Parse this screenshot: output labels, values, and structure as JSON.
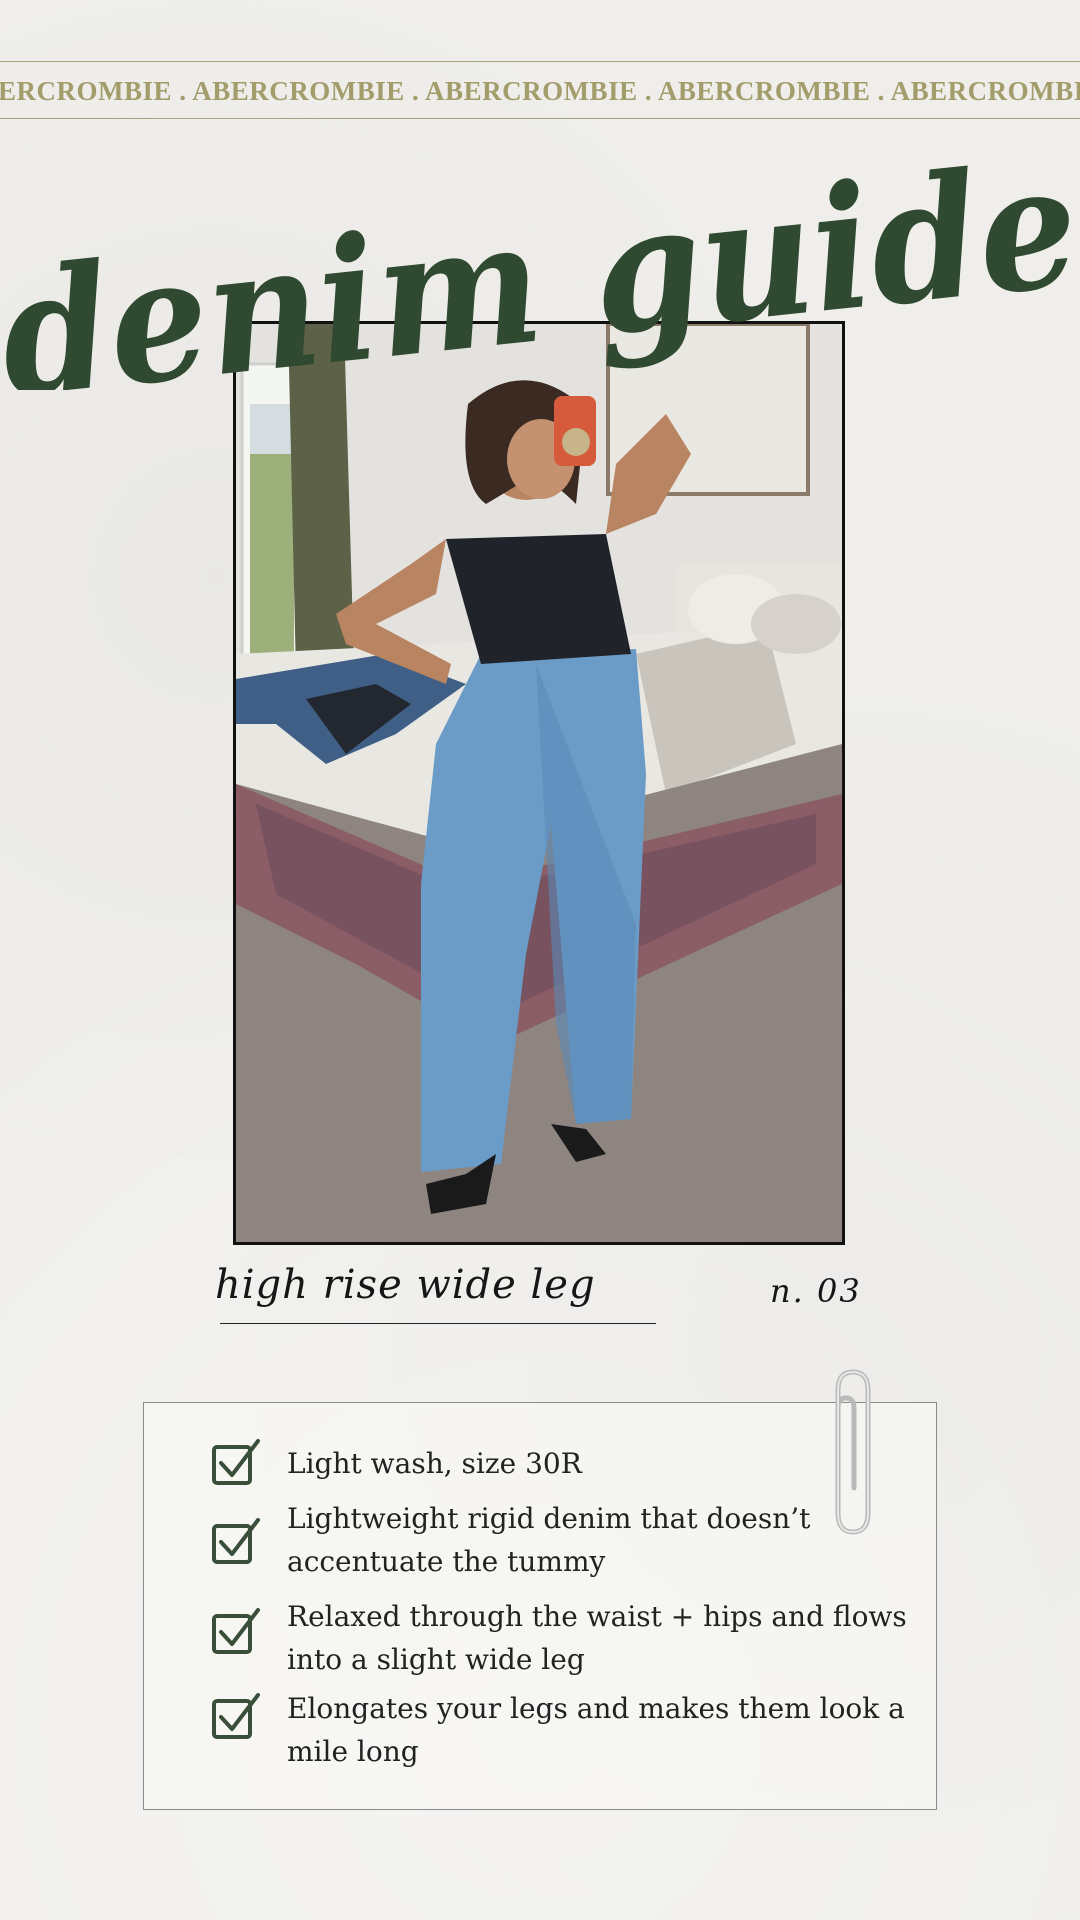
{
  "brand_ticker": "ERCROMBIE . ABERCROMBIE . ABERCROMBIE .  ABERCROMBIE . ABERCROMBIE",
  "title": "denim guide",
  "caption": "high rise wide leg",
  "number": "n. 03",
  "checklist": [
    {
      "text": "Light wash, size 30R",
      "icon": "checkbox-checked-icon"
    },
    {
      "text": "Lightweight rigid denim that doesn’t accentuate the tummy",
      "icon": "checkbox-checked-icon"
    },
    {
      "text": "Relaxed through the waist + hips and flows into a slight wide leg",
      "icon": "checkbox-checked-icon"
    },
    {
      "text": "Elongates your legs and makes them look a mile long",
      "icon": "checkbox-checked-icon"
    }
  ],
  "colors": {
    "background": "#efeeeb",
    "title_green": "#2f4a30",
    "ticker_gold": "#a39d6b",
    "check_green": "#3a4f3a"
  }
}
